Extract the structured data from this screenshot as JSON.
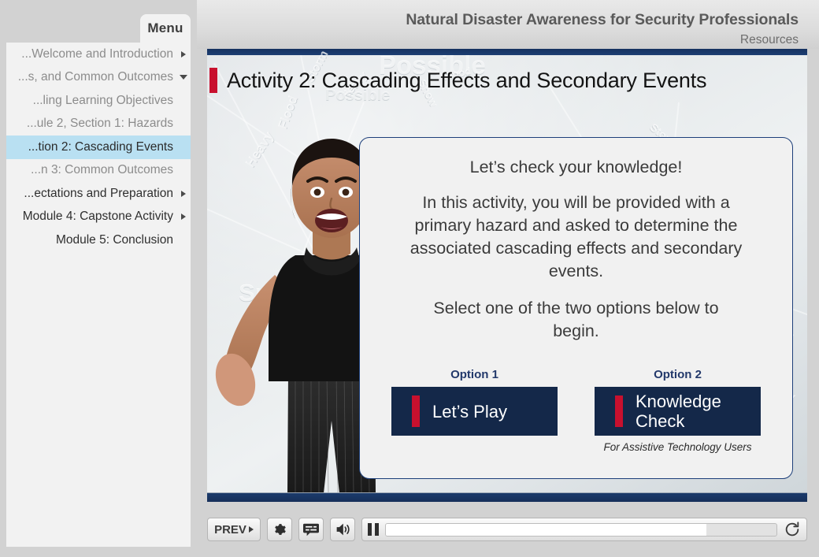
{
  "sidebar": {
    "tab_label": "Menu",
    "items": [
      {
        "label": "...Welcome and Introduction",
        "arrow": "right",
        "tone": "muted",
        "active": false
      },
      {
        "label": "...s, and Common Outcomes",
        "arrow": "down",
        "tone": "muted",
        "active": false
      },
      {
        "label": "...ling Learning Objectives",
        "arrow": "none",
        "tone": "muted",
        "active": false
      },
      {
        "label": "...ule 2, Section 1: Hazards",
        "arrow": "none",
        "tone": "muted",
        "active": false
      },
      {
        "label": "...tion 2: Cascading Events",
        "arrow": "none",
        "tone": "dark",
        "active": true
      },
      {
        "label": "...n 3: Common Outcomes",
        "arrow": "none",
        "tone": "muted",
        "active": false
      },
      {
        "label": "...ectations and Preparation",
        "arrow": "right",
        "tone": "dark",
        "active": false
      },
      {
        "label": "Module 4: Capstone Activity",
        "arrow": "right",
        "tone": "dark",
        "active": false
      },
      {
        "label": "Module 5: Conclusion",
        "arrow": "none",
        "tone": "dark",
        "active": false
      }
    ]
  },
  "header": {
    "course_title": "Natural Disaster Awareness for Security Professionals",
    "resources_label": "Resources"
  },
  "slide": {
    "title": "Activity 2: Cascading Effects and Secondary Events",
    "accent_color": "#c8102e",
    "topbar_color": "#1d3f74",
    "background_words": [
      "Possible",
      "Snow",
      "Heavy",
      "Flood",
      "Winds",
      "Storm"
    ]
  },
  "card": {
    "lead": "Let’s check your knowledge!",
    "body": "In this activity, you will be provided with a primary hazard and asked to determine the associated cascading effects and secondary events.",
    "select_prompt": "Select one of the two options below to begin.",
    "options": [
      {
        "label": "Option 1",
        "button_text": "Let’s Play",
        "note": ""
      },
      {
        "label": "Option 2",
        "button_text": "Knowledge Check",
        "note": "For Assistive Technology Users"
      }
    ],
    "button_color": "#142849",
    "border_color": "#1d3f7a"
  },
  "controls": {
    "prev_label": "PREV",
    "settings_icon": "gear-icon",
    "captions_icon": "captions-icon",
    "volume_icon": "volume-icon",
    "playstate_icon": "pause-icon",
    "replay_icon": "replay-icon",
    "progress_percent": 82
  }
}
